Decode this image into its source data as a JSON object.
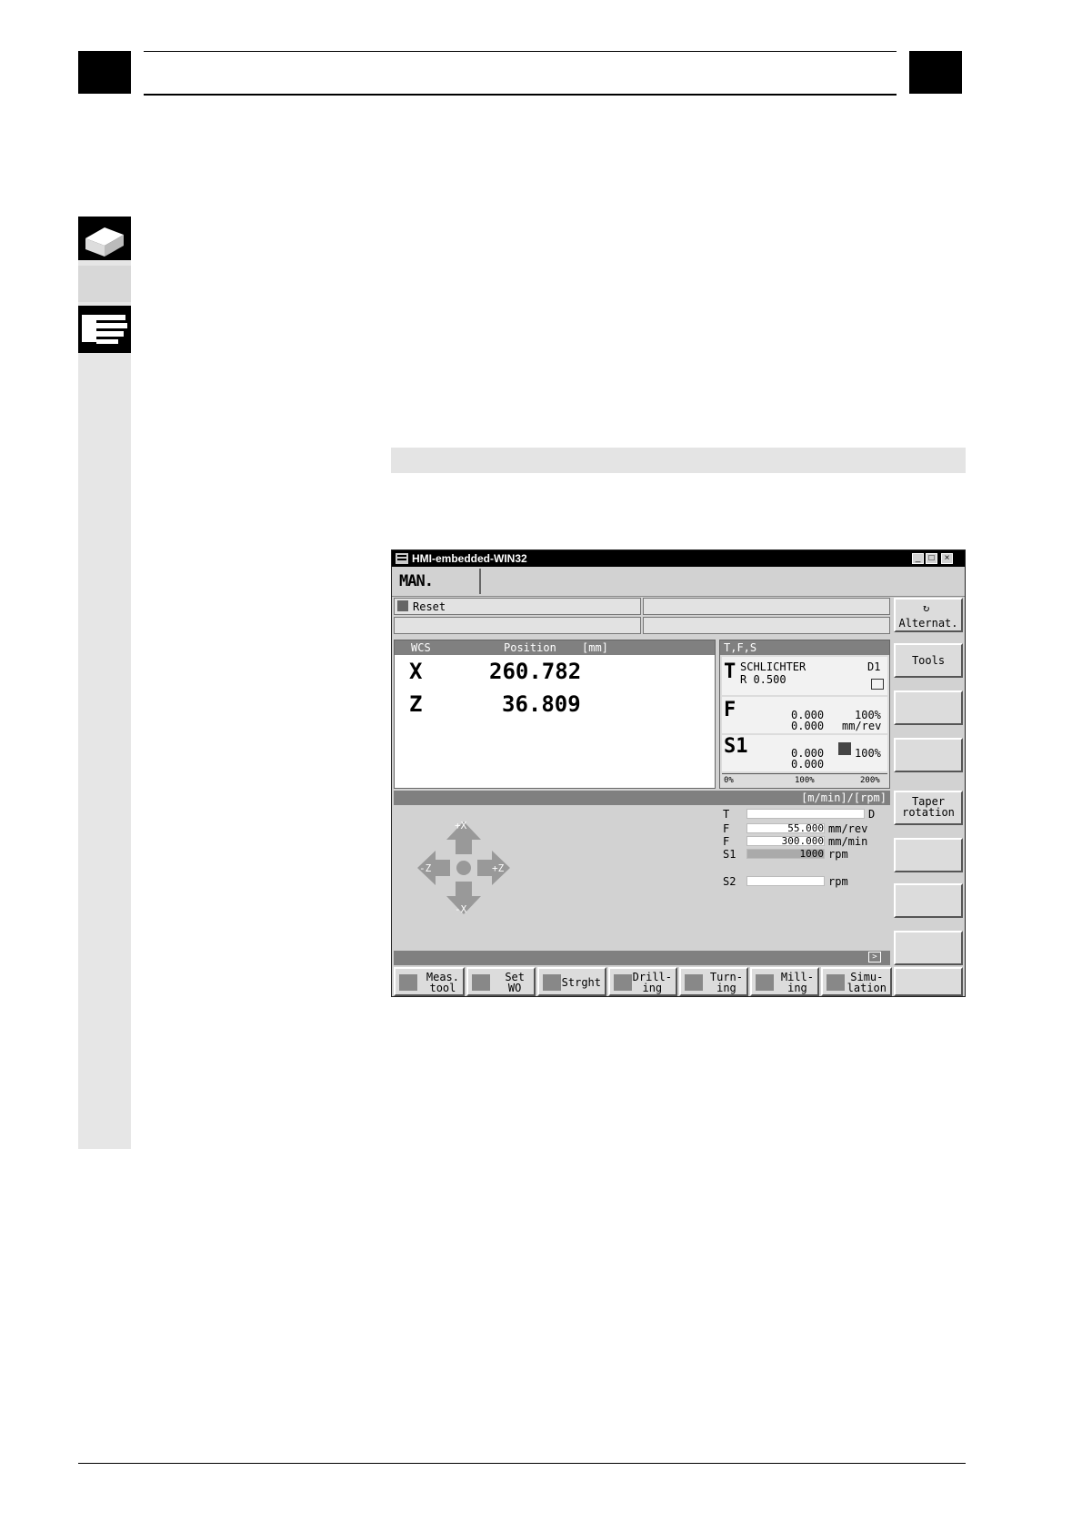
{
  "hmi": {
    "title": "HMI-embedded-WIN32",
    "mode": "MAN.",
    "status_reset": "Reset",
    "wcs": {
      "header_wcs": "WCS",
      "header_position": "Position",
      "header_unit": "[mm]",
      "axes": [
        {
          "name": "X",
          "value": "260.782"
        },
        {
          "name": "Z",
          "value": "36.809"
        }
      ]
    },
    "tfs": {
      "header": "T,F,S",
      "t_label": "T",
      "tool_name": "SCHLICHTER",
      "tool_radius": "R 0.500",
      "d_label": "D1",
      "f_label": "F",
      "f_value1": "0.000",
      "f_value2": "0.000",
      "f_percent": "100%",
      "f_unit": "mm/rev",
      "s_label": "S1",
      "s_value1": "0.000",
      "s_value2": "0.000",
      "s_percent": "100%",
      "scale": [
        "0%",
        "100%",
        "200%"
      ]
    },
    "jog": {
      "header_unit": "[m/min]/[rpm]",
      "arrows": {
        "up": "+X",
        "down": "-X",
        "left": "-Z",
        "right": "+Z"
      },
      "rows": [
        {
          "label": "T",
          "value": "",
          "unit": "D"
        },
        {
          "label": "F",
          "value": "55.000",
          "unit": "mm/rev"
        },
        {
          "label": "F",
          "value": "300.000",
          "unit": "mm/min"
        },
        {
          "label": "S1",
          "value": "1000",
          "unit": "rpm"
        },
        {
          "label": "S2",
          "value": "",
          "unit": "rpm"
        }
      ]
    },
    "vertical_softkeys": [
      "Alternat.",
      "Tools",
      "",
      "",
      "Taper\nrotation",
      "",
      "",
      ""
    ],
    "horizontal_softkeys": [
      {
        "line1": "Meas.",
        "line2": "tool"
      },
      {
        "line1": "Set",
        "line2": "WO"
      },
      {
        "line1": "Strght",
        "line2": ""
      },
      {
        "line1": "Drill-",
        "line2": "ing"
      },
      {
        "line1": "Turn-",
        "line2": "ing"
      },
      {
        "line1": "Mill-",
        "line2": "ing"
      },
      {
        "line1": "Simu-",
        "line2": "lation"
      },
      {
        "line1": "",
        "line2": ""
      }
    ]
  }
}
